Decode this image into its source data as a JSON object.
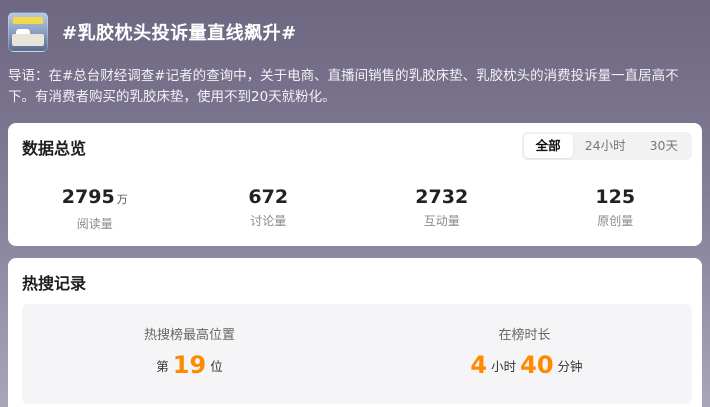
{
  "topic": {
    "title": "#乳胶枕头投诉量直线飙升#",
    "intro": "导语：在#总台财经调查#记者的查询中，关于电商、直播间销售的乳胶床垫、乳胶枕头的消费投诉量一直居高不下。有消费者购买的乳胶床垫，使用不到20天就粉化。"
  },
  "overview": {
    "title": "数据总览",
    "tabs": [
      "全部",
      "24小时",
      "30天"
    ],
    "active_tab": "全部",
    "stats": [
      {
        "value": "2795",
        "unit": "万",
        "label": "阅读量"
      },
      {
        "value": "672",
        "unit": "",
        "label": "讨论量"
      },
      {
        "value": "2732",
        "unit": "",
        "label": "互动量"
      },
      {
        "value": "125",
        "unit": "",
        "label": "原创量"
      }
    ]
  },
  "hot_record": {
    "title": "热搜记录",
    "peak": {
      "label": "热搜榜最高位置",
      "prefix": "第",
      "value": "19",
      "suffix": "位"
    },
    "duration": {
      "label": "在榜时长",
      "hours": "4",
      "hours_unit": "小时",
      "minutes": "40",
      "minutes_unit": "分钟"
    }
  },
  "colors": {
    "accent": "#ff8a00",
    "header_bg": "#6d6782"
  }
}
